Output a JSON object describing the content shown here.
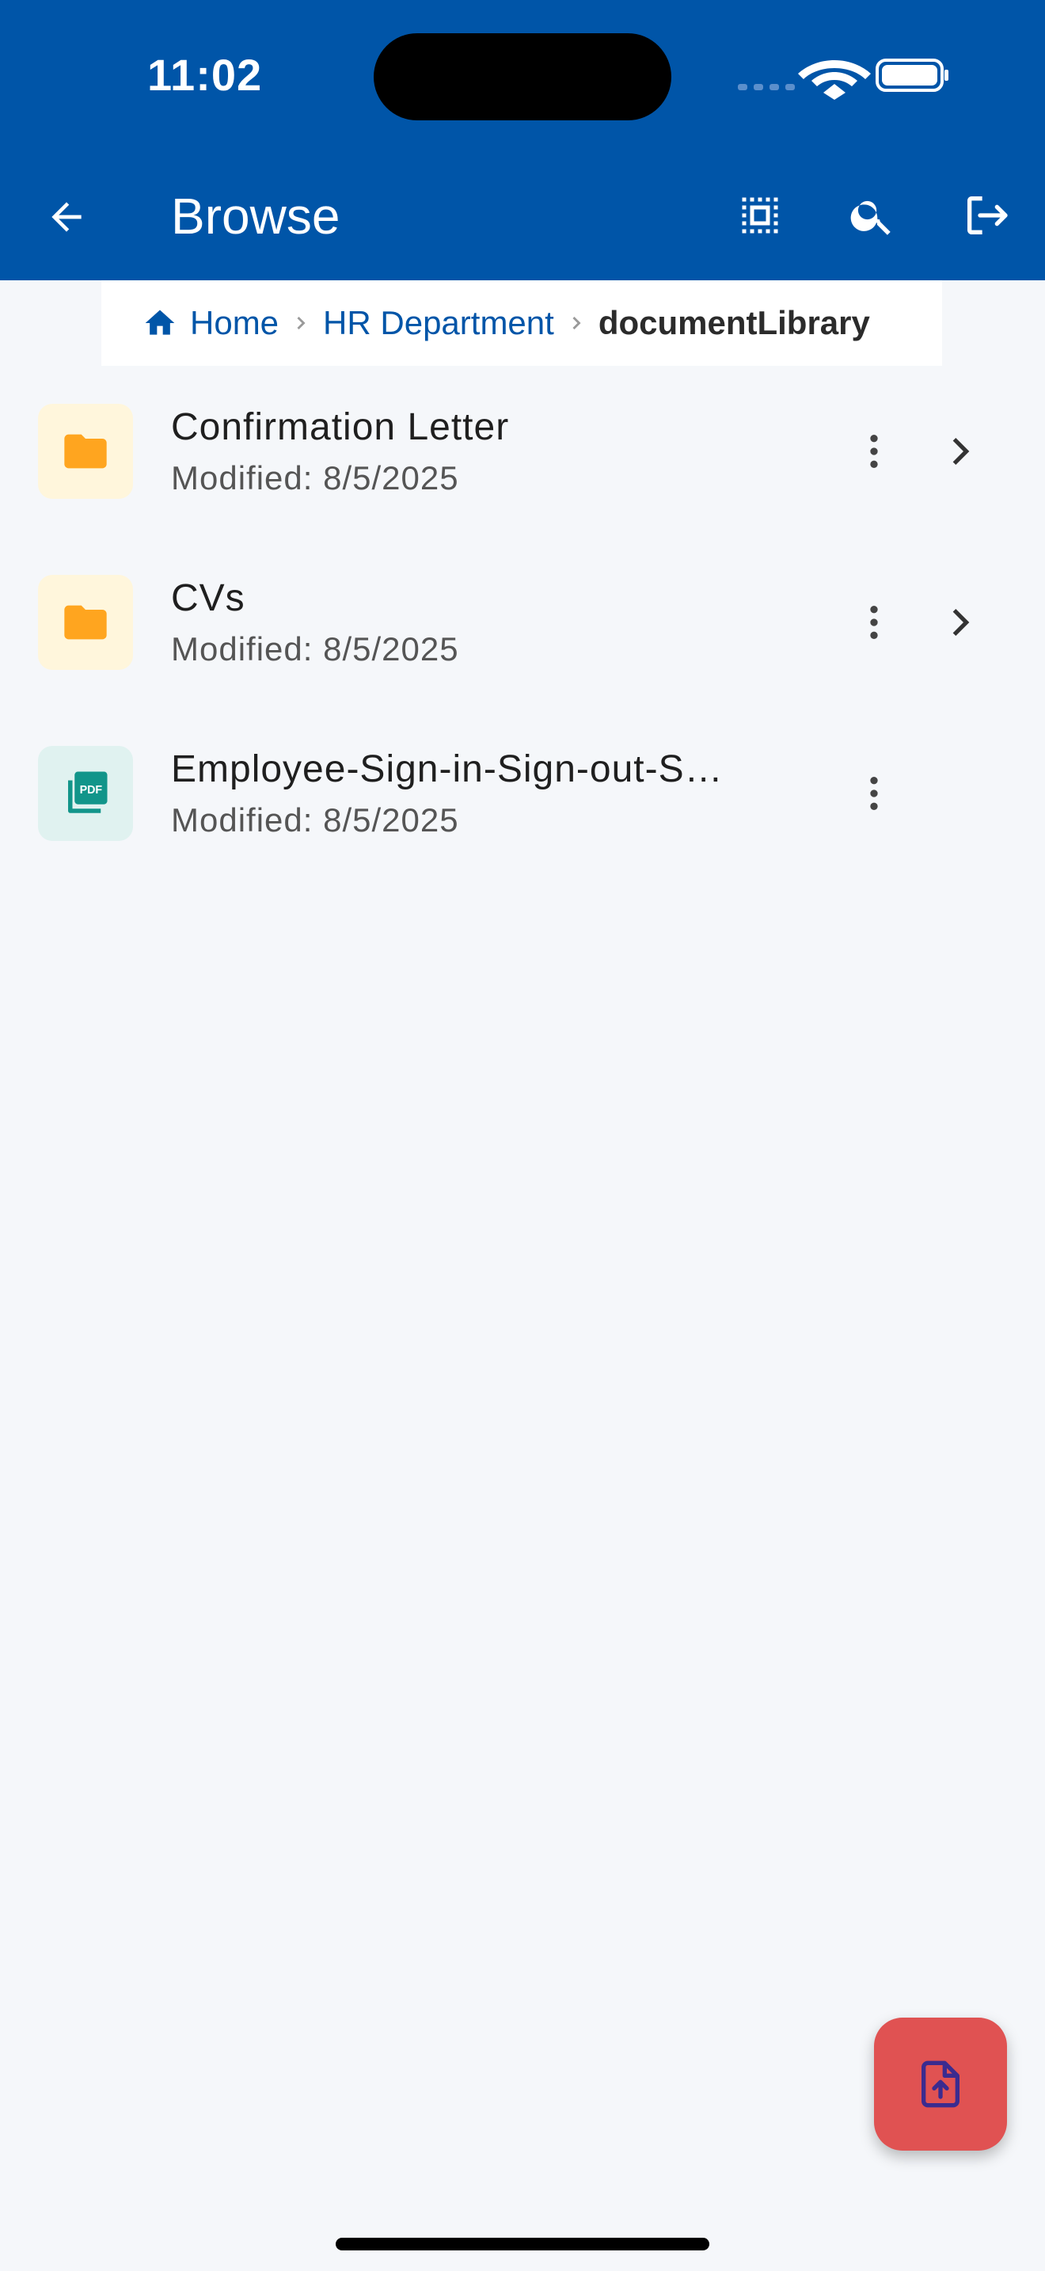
{
  "status": {
    "time": "11:02"
  },
  "appbar": {
    "title": "Browse"
  },
  "breadcrumb": {
    "items": [
      {
        "label": "Home"
      },
      {
        "label": "HR Department"
      }
    ],
    "current": "documentLibrary"
  },
  "list": {
    "items": [
      {
        "name": "Confirmation Letter",
        "modified": "Modified: 8/5/2025",
        "type": "folder"
      },
      {
        "name": "CVs",
        "modified": "Modified: 8/5/2025",
        "type": "folder"
      },
      {
        "name": "Employee-Sign-in-Sign-out-S…",
        "modified": "Modified: 8/5/2025",
        "type": "pdf"
      }
    ]
  },
  "icons": {
    "back": "arrow-left-icon",
    "select": "select-all-icon",
    "search": "search-icon",
    "logout": "logout-icon",
    "folder": "folder-icon",
    "pdf": "pdf-icon",
    "more": "more-vertical-icon",
    "chevron": "chevron-right-icon",
    "upload": "upload-file-icon"
  },
  "colors": {
    "primary": "#0055a8",
    "fab": "#e05252",
    "folder": "#ffa51f",
    "pdf": "#12958a"
  }
}
